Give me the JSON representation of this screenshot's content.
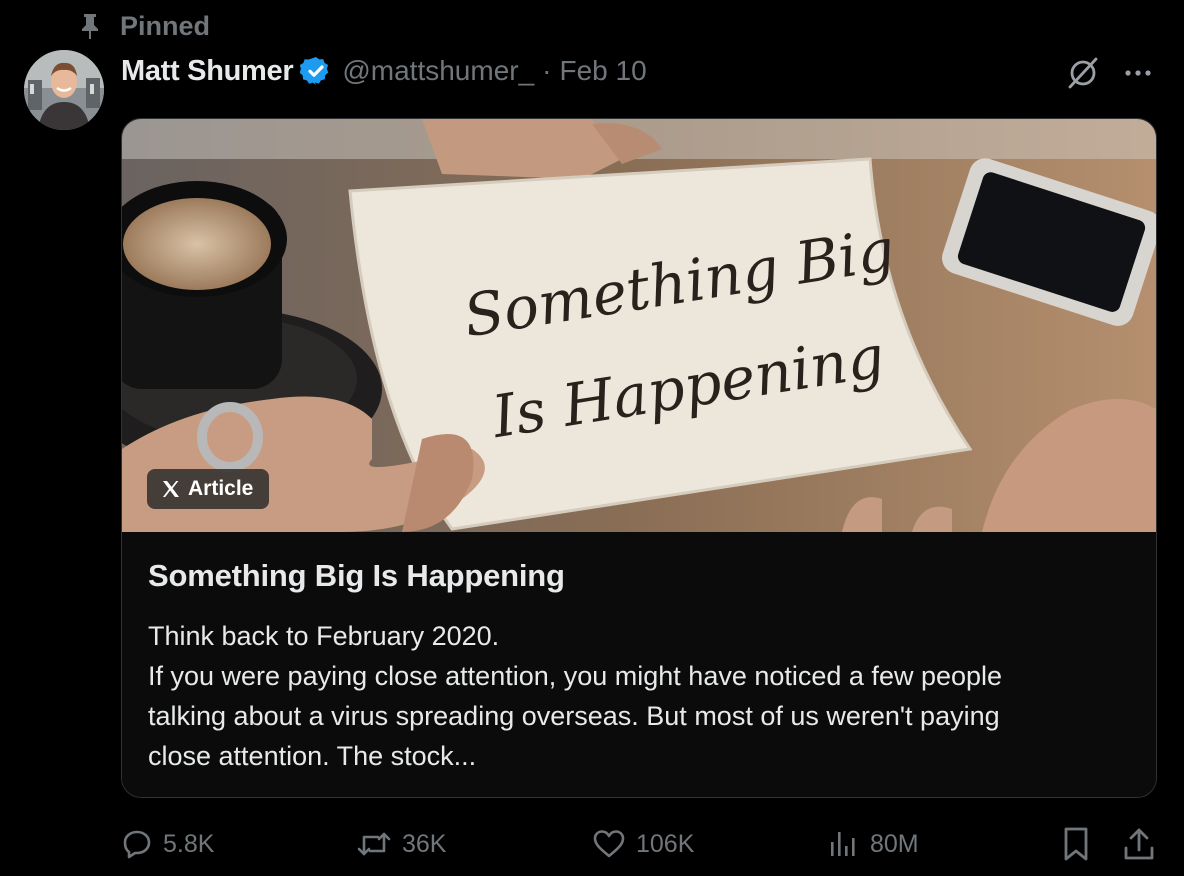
{
  "pinned": {
    "label": "Pinned",
    "icon": "pin-icon"
  },
  "author": {
    "display_name": "Matt Shumer",
    "verified_icon": "verified-badge-icon",
    "handle": "@mattshumer_",
    "separator": "·",
    "date": "Feb 10"
  },
  "header_actions": {
    "grok_icon": "grok-icon",
    "more_icon": "more-options-icon"
  },
  "article": {
    "badge_label": "Article",
    "image_text_line1": "Something Big",
    "image_text_line2": "Is Happening",
    "title": "Something Big Is Happening",
    "excerpt_lines": [
      "Think back to February 2020.",
      "If you were paying close attention, you might have noticed a few people",
      "talking about a virus spreading overseas. But most of us weren't paying",
      "close attention. The stock..."
    ]
  },
  "actions": {
    "replies": "5.8K",
    "reposts": "36K",
    "likes": "106K",
    "views": "80M"
  },
  "colors": {
    "background": "#000000",
    "text_primary": "#e7e9ea",
    "text_secondary": "#71767b",
    "verified_blue": "#1d9bf0",
    "card_border": "#2f3336"
  }
}
